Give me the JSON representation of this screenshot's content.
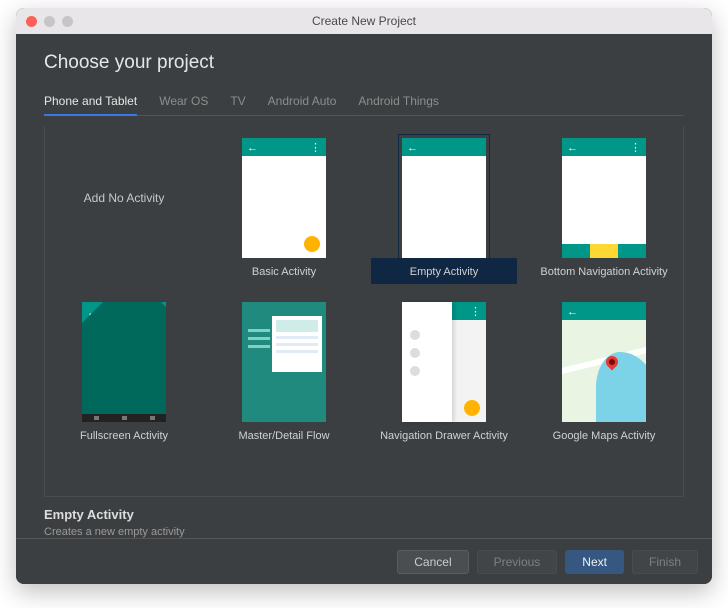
{
  "window_title": "Create New Project",
  "page_title": "Choose your project",
  "tabs": [
    {
      "label": "Phone and Tablet",
      "active": true
    },
    {
      "label": "Wear OS",
      "active": false
    },
    {
      "label": "TV",
      "active": false
    },
    {
      "label": "Android Auto",
      "active": false
    },
    {
      "label": "Android Things",
      "active": false
    }
  ],
  "templates": [
    {
      "id": "no-activity",
      "label": "Add No Activity",
      "selected": false
    },
    {
      "id": "basic-activity",
      "label": "Basic Activity",
      "selected": false
    },
    {
      "id": "empty-activity",
      "label": "Empty Activity",
      "selected": true
    },
    {
      "id": "bottom-nav",
      "label": "Bottom Navigation Activity",
      "selected": false
    },
    {
      "id": "fullscreen",
      "label": "Fullscreen Activity",
      "selected": false
    },
    {
      "id": "master-detail",
      "label": "Master/Detail Flow",
      "selected": false
    },
    {
      "id": "nav-drawer",
      "label": "Navigation Drawer Activity",
      "selected": false
    },
    {
      "id": "google-maps",
      "label": "Google Maps Activity",
      "selected": false
    }
  ],
  "detail": {
    "title": "Empty Activity",
    "description": "Creates a new empty activity"
  },
  "buttons": {
    "cancel": "Cancel",
    "previous": "Previous",
    "next": "Next",
    "finish": "Finish"
  },
  "colors": {
    "accent": "#365880",
    "teal": "#009688",
    "amber": "#ffb300"
  }
}
